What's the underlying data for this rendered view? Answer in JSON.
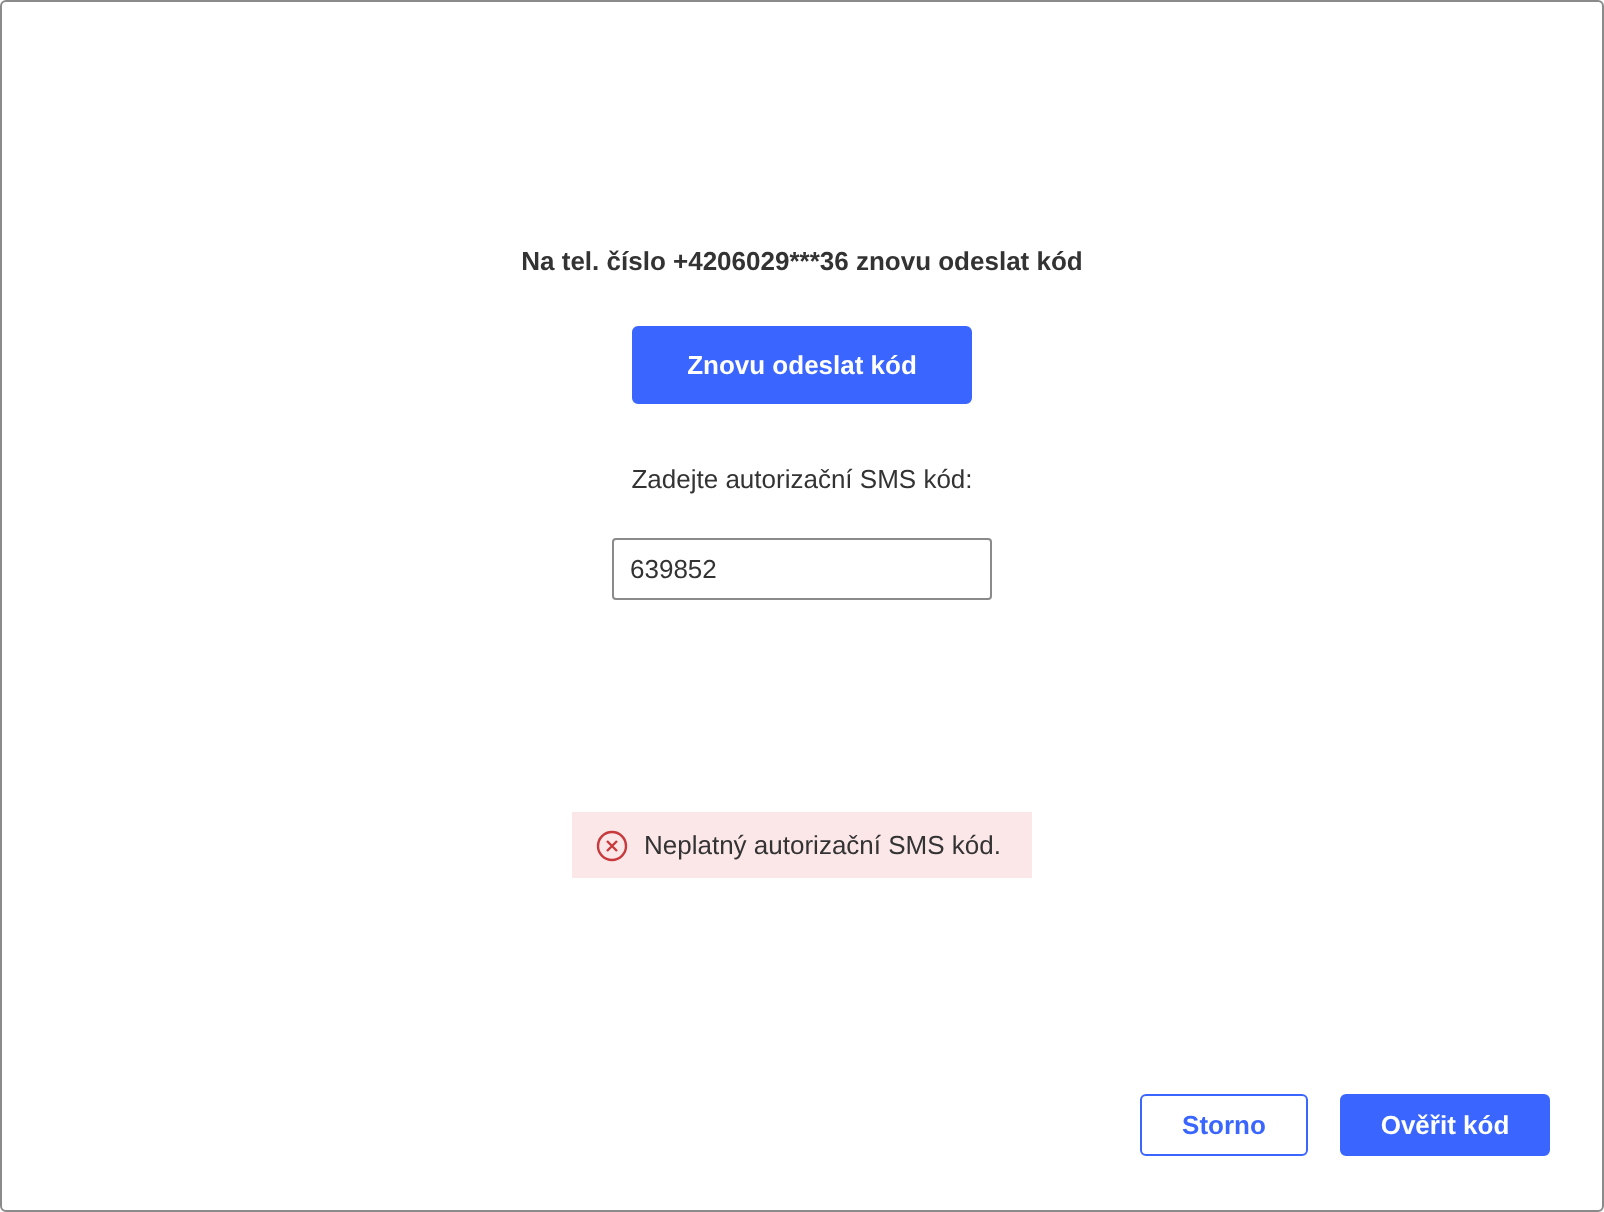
{
  "message": "Na tel. číslo +4206029***36 znovu odeslat kód",
  "resend_button": {
    "label": "Znovu odeslat kód"
  },
  "code_label": "Zadejte autorizační SMS kód:",
  "code_field": {
    "value": "639852"
  },
  "error": {
    "text": "Neplatný autorizační SMS kód."
  },
  "buttons": [
    {
      "label": "Storno",
      "kind": "secondary"
    },
    {
      "label": "Ověřit kód",
      "kind": "primary"
    }
  ]
}
